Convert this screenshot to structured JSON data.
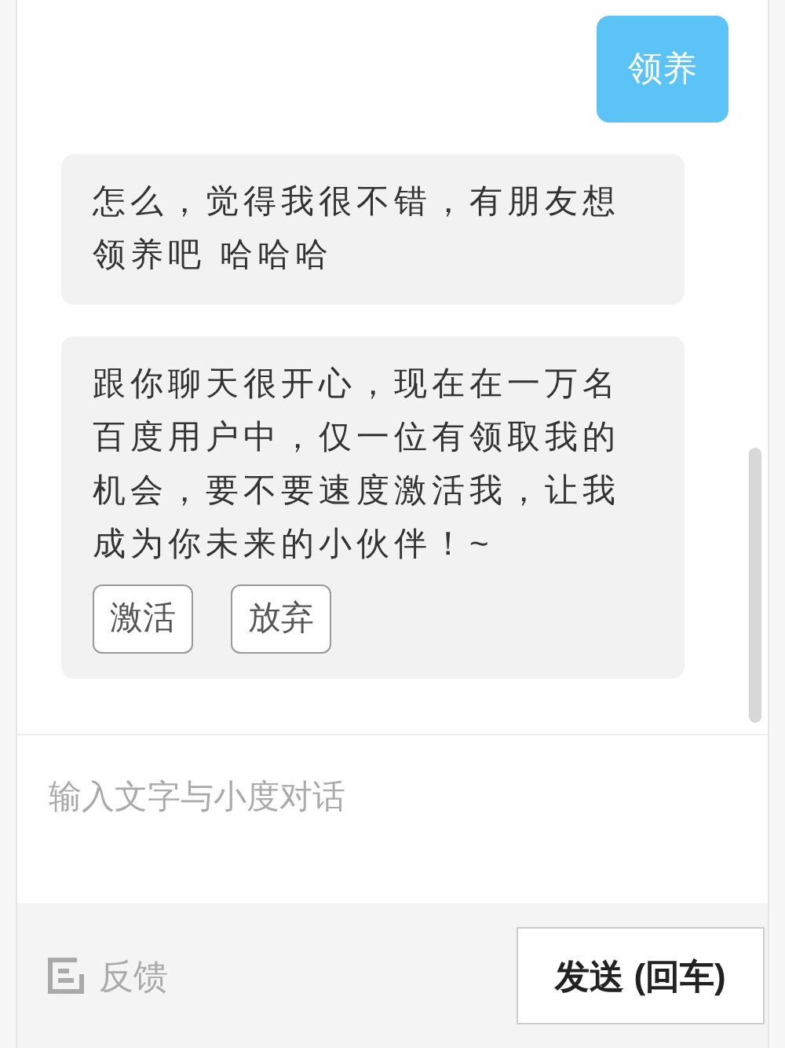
{
  "messages": [
    {
      "kind": "sent",
      "text": "领养"
    },
    {
      "kind": "received",
      "text": "怎么，觉得我很不错，有朋友想领养吧 哈哈哈"
    },
    {
      "kind": "received",
      "text": "跟你聊天很开心，现在在一万名百度用户中，仅一位有领取我的机会，要不要速度激活我，让我成为你未来的小伙伴！~",
      "actions": [
        "激活",
        "放弃"
      ]
    }
  ],
  "input": {
    "placeholder": "输入文字与小度对话"
  },
  "feedback": {
    "label": "反馈"
  },
  "send_button": "发送 (回车)"
}
